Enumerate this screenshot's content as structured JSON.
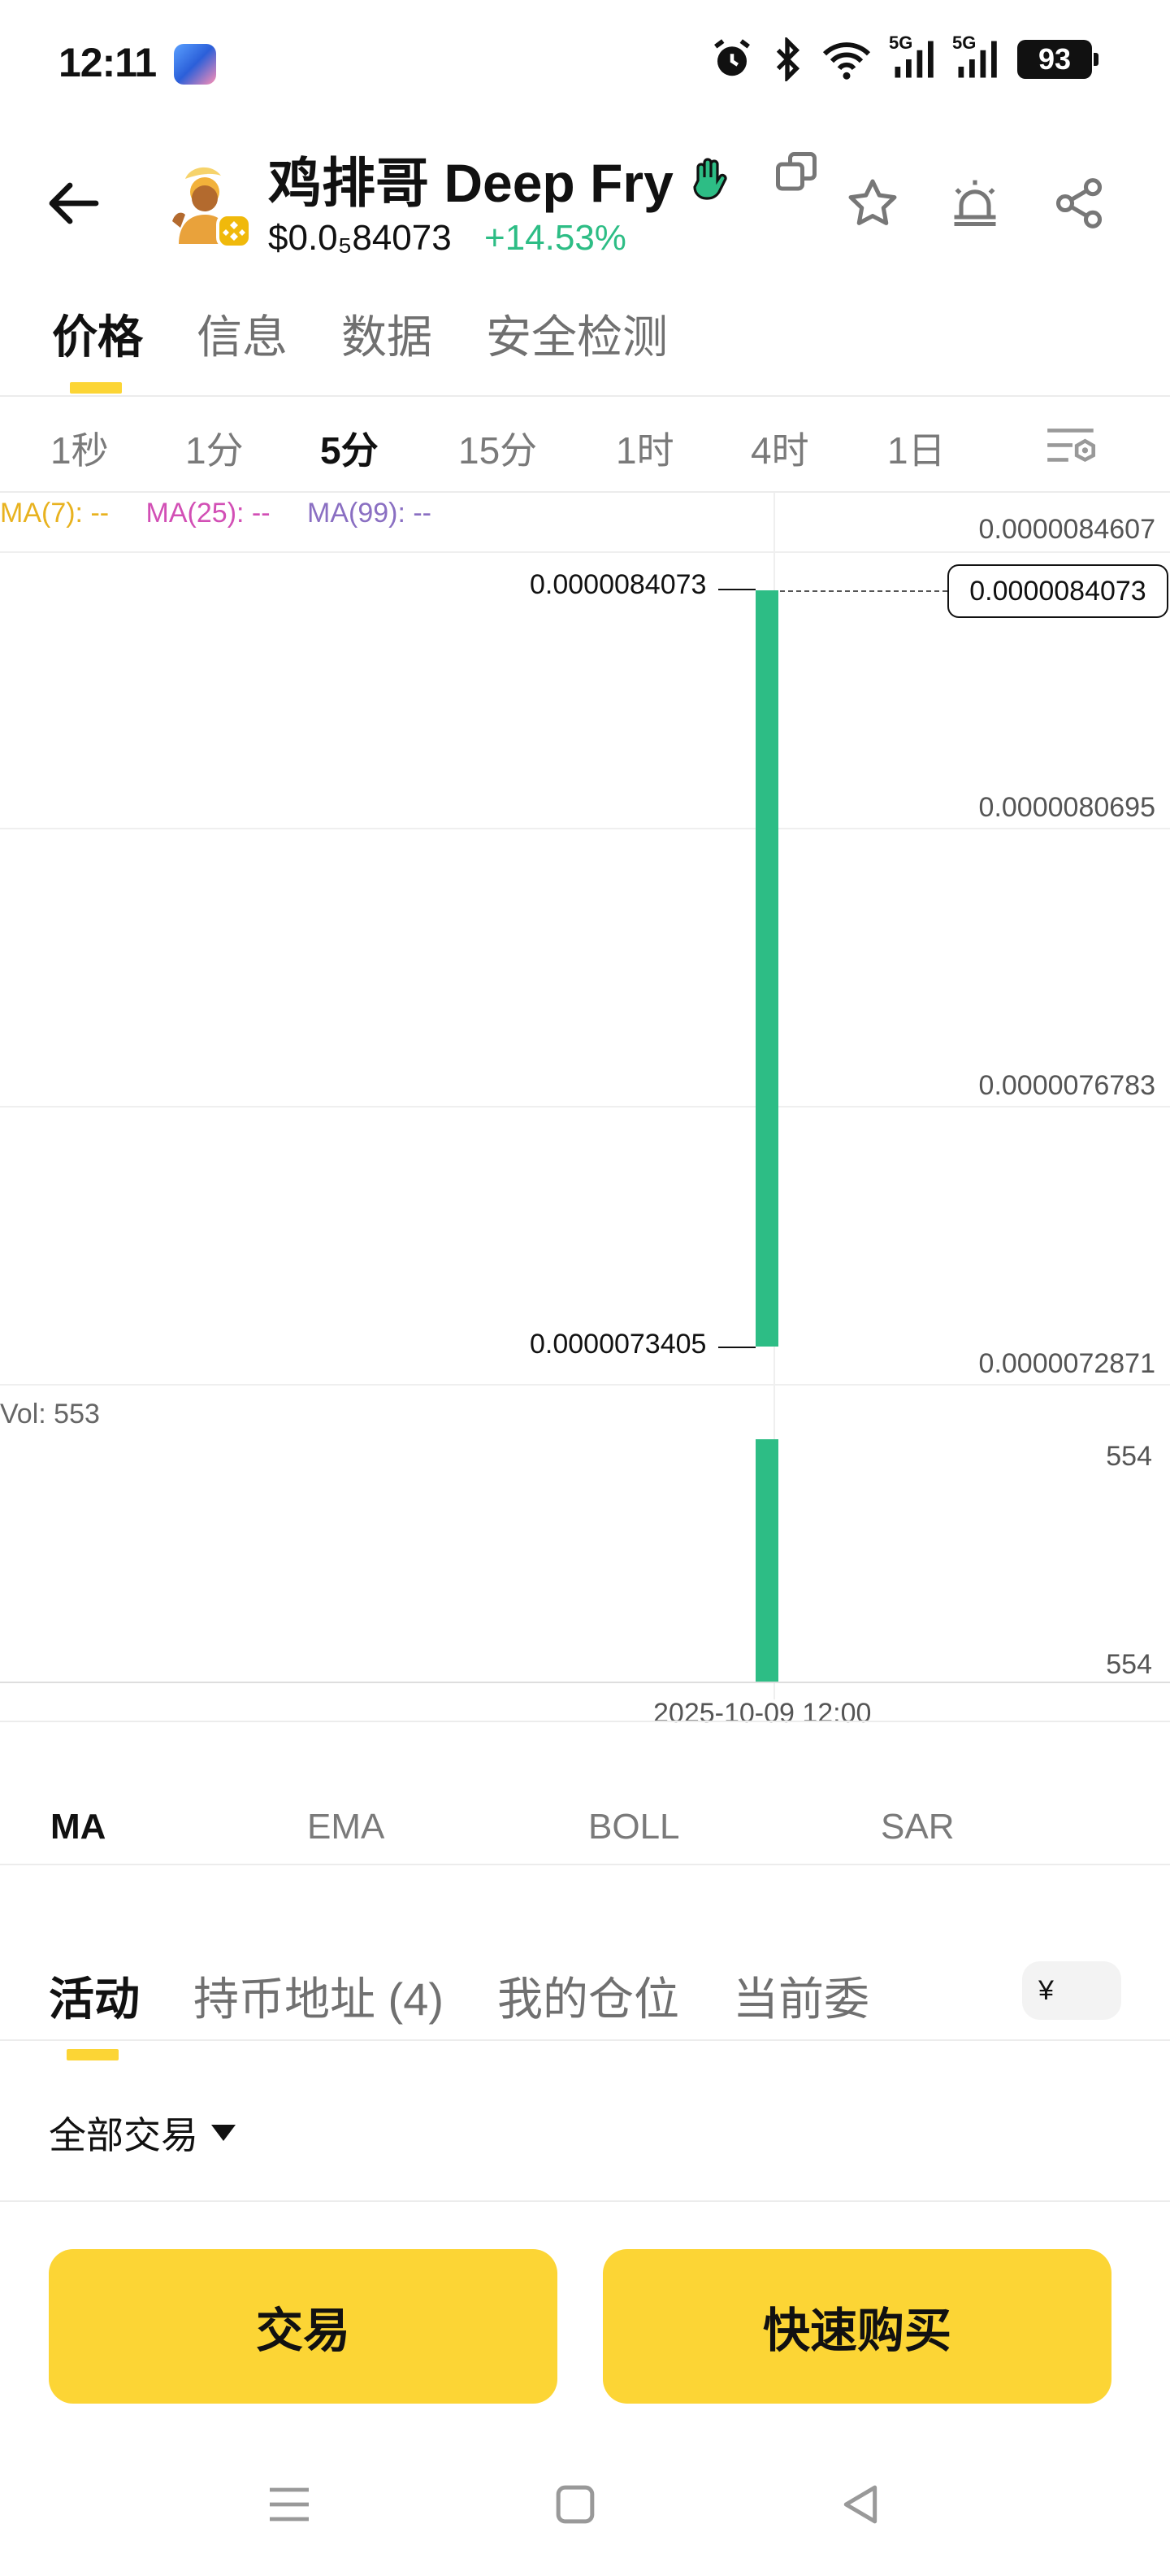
{
  "status_bar": {
    "time": "12:11",
    "signal_1": "5G",
    "signal_2": "5G",
    "battery": "93"
  },
  "header": {
    "token_name": "鸡排哥 Deep Fry",
    "price": "$0.0₅84073",
    "change": "+14.53%",
    "change_color": "#2dbd85",
    "icons": [
      "back-arrow-icon",
      "bnb-chain-badge-icon",
      "hand-wave-icon",
      "copy-icon",
      "star-icon",
      "alarm-icon",
      "share-icon"
    ]
  },
  "main_tabs": [
    "价格",
    "信息",
    "数据",
    "安全检测"
  ],
  "main_tab_active": "价格",
  "intervals": [
    "1秒",
    "1分",
    "5分",
    "15分",
    "1时",
    "4时",
    "1日"
  ],
  "interval_active": "5分",
  "chart": {
    "ma": {
      "ma7": "MA(7): --",
      "ma25": "MA(25): --",
      "ma99": "MA(99): --",
      "colors": {
        "ma7": "#e8b21f",
        "ma25": "#d24fb5",
        "ma99": "#8a6fc2"
      }
    },
    "price_axis": [
      "0.0000084607",
      "0.0000080695",
      "0.0000076783",
      "0.0000072871"
    ],
    "high_label": "0.0000084073",
    "low_label": "0.0000073405",
    "last_price": "0.0000084073",
    "volume_label": "Vol: 553",
    "volume_axis": [
      "554",
      "554"
    ],
    "date_label": "2025-10-09 12:00",
    "candle_color": "#2dbd85"
  },
  "chart_data": {
    "type": "candlestick",
    "x": [
      "2025-10-09 12:00"
    ],
    "series": [
      {
        "open": 7.3405e-06,
        "high": 8.4073e-06,
        "low": 7.3405e-06,
        "close": 8.4073e-06,
        "volume": 553
      }
    ],
    "ylim": [
      7.2871e-06,
      8.4607e-06
    ]
  },
  "indicators": [
    "MA",
    "EMA",
    "BOLL",
    "SAR"
  ],
  "indicator_active": "MA",
  "activity_tabs": [
    "活动",
    "持币地址 (4)",
    "我的仓位",
    "当前委"
  ],
  "activity_tab_active": "活动",
  "currency": "¥",
  "filter": "全部交易",
  "buttons": {
    "trade": "交易",
    "quick_buy": "快速购买",
    "color": "#fcd535"
  },
  "nav": [
    "menu-icon",
    "home-square-icon",
    "back-triangle-icon"
  ]
}
